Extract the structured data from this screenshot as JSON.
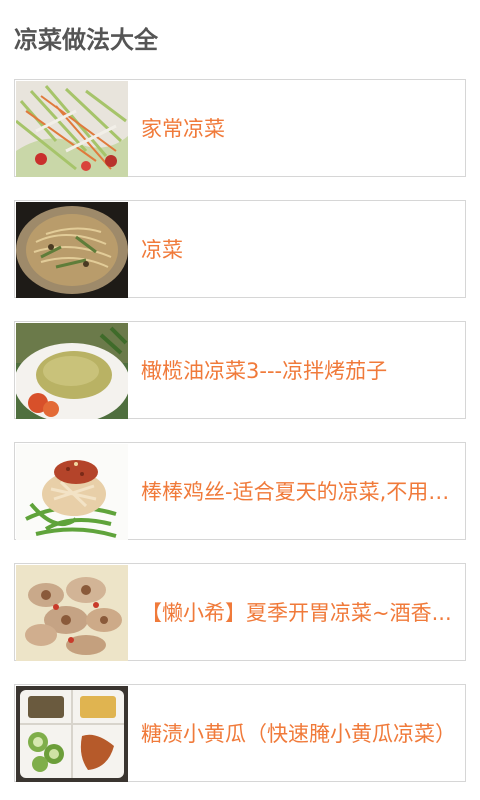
{
  "header": {
    "title": "凉菜做法大全"
  },
  "recipes": [
    {
      "title": "家常凉菜",
      "image": "cold-salad-photo"
    },
    {
      "title": "凉菜",
      "image": "cold-noodle-photo"
    },
    {
      "title": "橄榄油凉菜3---凉拌烤茄子",
      "image": "eggplant-photo"
    },
    {
      "title": "棒棒鸡丝-适合夏天的凉菜,不用动...",
      "image": "chicken-shred-photo"
    },
    {
      "title": "【懒小希】夏季开胃凉菜~酒香...",
      "image": "fried-rings-photo"
    },
    {
      "title": "糖渍小黄瓜（快速腌小黄瓜凉菜）",
      "image": "pickled-cucumber-photo"
    }
  ],
  "colors": {
    "title": "#555555",
    "accent": "#f07a3a",
    "border": "#d6d6d6"
  }
}
